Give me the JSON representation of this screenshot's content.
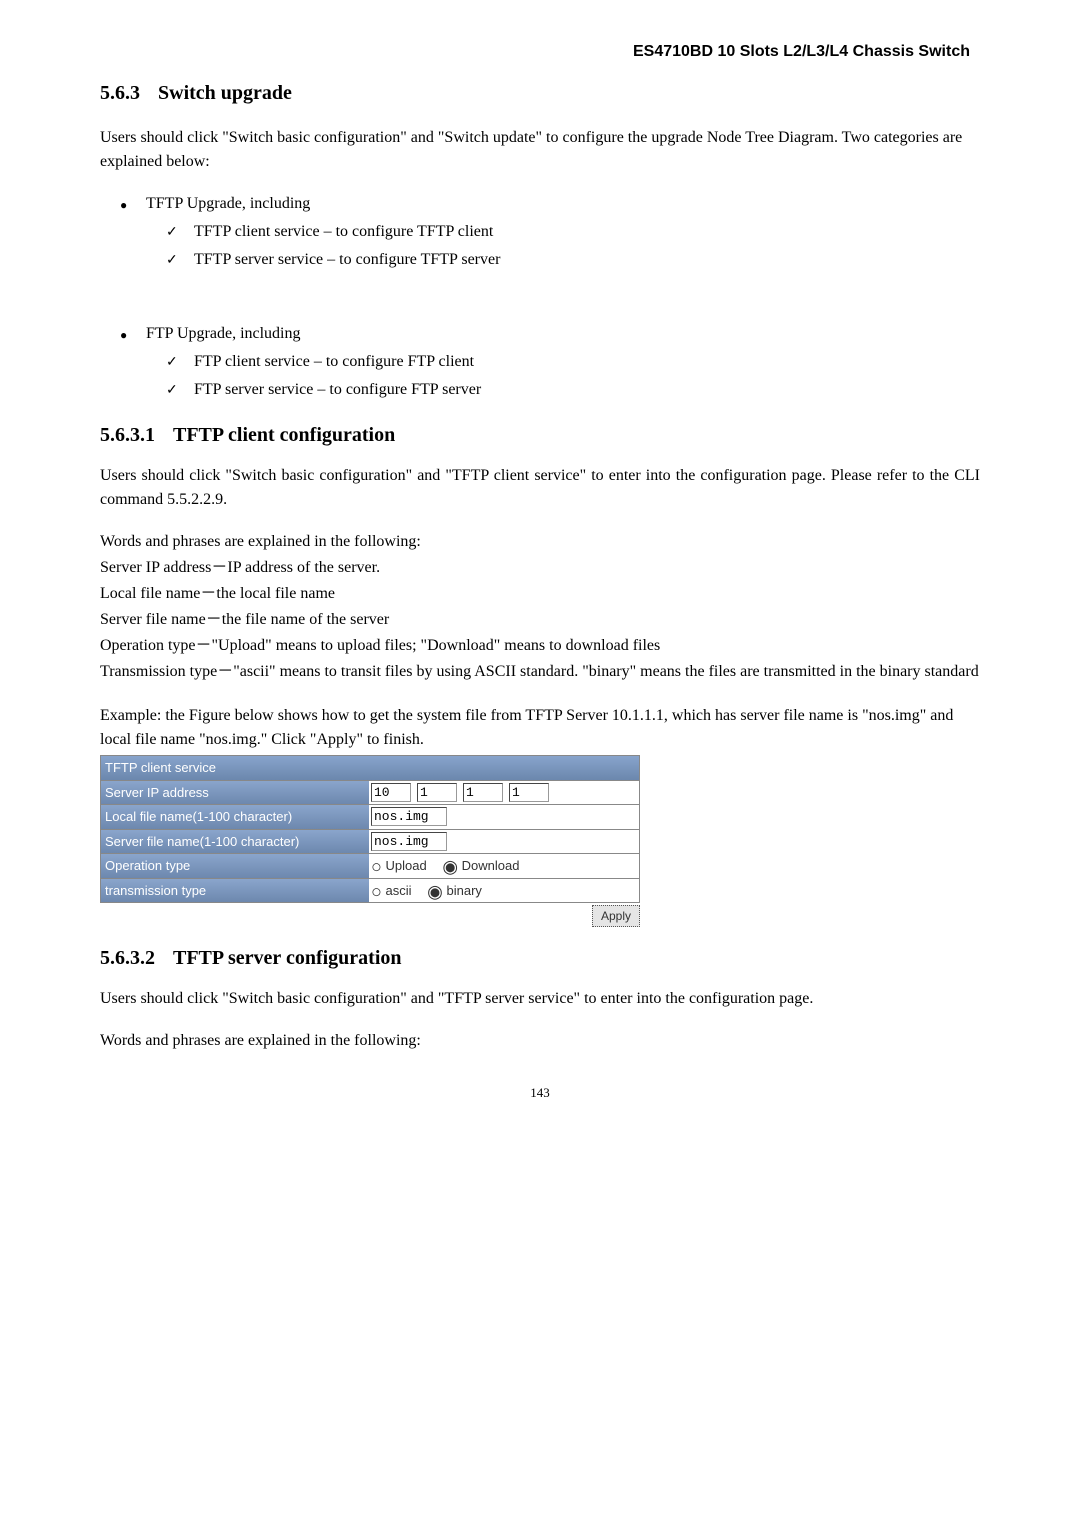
{
  "header_title": "ES4710BD 10 Slots L2/L3/L4 Chassis Switch",
  "section_563": {
    "num": "5.6.3",
    "title": "Switch upgrade",
    "intro": "Users should click \"Switch basic configuration\" and \"Switch update\" to configure the upgrade Node Tree Diagram. Two categories are explained below:",
    "bullet1": {
      "title": "TFTP Upgrade, including",
      "item1": "TFTP client service – to configure TFTP client",
      "item2": "TFTP server service – to configure TFTP server"
    },
    "bullet2": {
      "title": "FTP Upgrade, including",
      "item1": "FTP client service – to configure FTP client",
      "item2": "FTP server service – to configure FTP server"
    }
  },
  "section_5631": {
    "num": "5.6.3.1",
    "title": "TFTP client configuration",
    "intro": "Users should click \"Switch basic configuration\" and \"TFTP client service\" to enter into the configuration page. Please refer to the CLI command 5.5.2.2.9.",
    "l1": "Words and phrases are explained in the following:",
    "l2": "Server IP address－IP address of the server.",
    "l3": "Local file name－the local file name",
    "l4": "Server file name－the file name of the server",
    "l5": "Operation type－\"Upload\" means to upload files; \"Download\" means to download files",
    "l6": "Transmission type－\"ascii\" means to transit files by using ASCII standard. \"binary\" means the files are transmitted in the binary standard",
    "example": "Example: the Figure below shows how to get the system file from TFTP Server 10.1.1.1, which has server file name is \"nos.img\" and local file name \"nos.img.\" Click \"Apply\" to finish."
  },
  "tftp_form": {
    "title": "TFTP client service",
    "row_ip_label": "Server IP address",
    "ip1": "10",
    "ip2": "1",
    "ip3": "1",
    "ip4": "1",
    "row_local_label": "Local file name(1-100 character)",
    "local_value": "nos.img",
    "row_server_label": "Server file name(1-100 character)",
    "server_value": "nos.img",
    "row_op_label": "Operation type",
    "op_upload": "Upload",
    "op_download": "Download",
    "row_trans_label": "transmission type",
    "trans_ascii": "ascii",
    "trans_binary": "binary",
    "apply": "Apply"
  },
  "section_5632": {
    "num": "5.6.3.2",
    "title": "TFTP server configuration",
    "intro": "Users should click \"Switch basic configuration\" and \"TFTP server service\" to enter into the configuration page.",
    "l1": "Words and phrases are explained in the following:"
  },
  "pagenum": "143"
}
